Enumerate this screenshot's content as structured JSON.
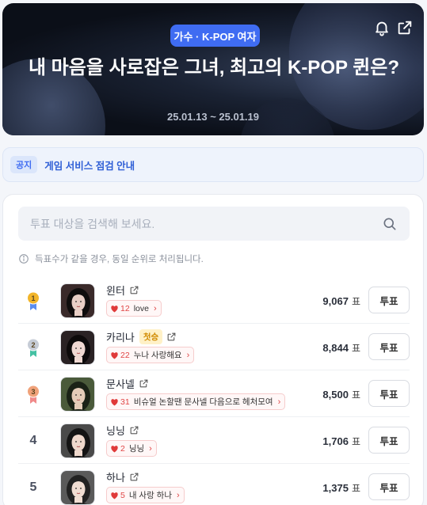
{
  "header": {
    "category": "가수 · K-POP 여자",
    "title": "내 마음을 사로잡은 그녀, 최고의 K-POP 퀸은?",
    "date_range": "25.01.13 ~ 25.01.19",
    "icons": [
      "bell-icon",
      "share-icon"
    ]
  },
  "notice": {
    "tag": "공지",
    "text": "게임 서비스 점검 안내"
  },
  "search": {
    "placeholder": "투표 대상을 검색해 보세요."
  },
  "info_text": "득표수가 같을 경우, 동일 순위로 처리됩니다.",
  "vote_unit": "표",
  "vote_button": "투표",
  "ranking": [
    {
      "rank": "1",
      "medal": "gold",
      "name": "윈터",
      "badge": "",
      "comment_count": "12",
      "comment": "love",
      "votes": "9,067"
    },
    {
      "rank": "2",
      "medal": "silver",
      "name": "카리나",
      "badge": "첫승",
      "comment_count": "22",
      "comment": "누나 사랑해요",
      "votes": "8,844"
    },
    {
      "rank": "3",
      "medal": "bronze",
      "name": "문사넬",
      "badge": "",
      "comment_count": "31",
      "comment": "비슈얼 논할땐 문사넬 다음으로 헤처모여",
      "votes": "8,500"
    },
    {
      "rank": "4",
      "medal": "",
      "name": "닝닝",
      "badge": "",
      "comment_count": "2",
      "comment": "닝닝",
      "votes": "1,706"
    },
    {
      "rank": "5",
      "medal": "",
      "name": "하나",
      "badge": "",
      "comment_count": "5",
      "comment": "내 사랑 하나",
      "votes": "1,375"
    }
  ],
  "colors": {
    "accent": "#3f6cf2",
    "heart": "#e03a3a",
    "gold": "#f2b52a",
    "silver": "#c6ccd6",
    "bronze": "#f0a27a"
  }
}
